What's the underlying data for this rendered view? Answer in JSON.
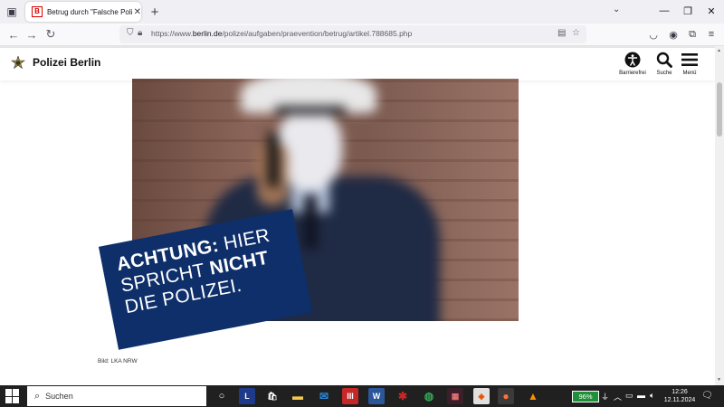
{
  "browser": {
    "tab_title": "Betrug durch \"Falsche Polizisten\"",
    "tab_favicon": "B",
    "url_prefix": "https://www.",
    "url_host": "berlin.de",
    "url_path": "/polizei/aufgaben/praevention/betrug/artikel.788685.php"
  },
  "site": {
    "title": "Polizei Berlin",
    "tools": [
      {
        "label": "Barrierefrei",
        "icon": "accessibility-icon"
      },
      {
        "label": "Suche",
        "icon": "search-icon"
      },
      {
        "label": "Menü",
        "icon": "hamburger-menu-icon"
      }
    ]
  },
  "hero": {
    "warning_line1_bold": "ACHTUNG:",
    "warning_line1_rest": " HIER",
    "warning_line2_rest": "SPRICHT ",
    "warning_line2_bold": "NICHT",
    "warning_line3": "DIE POLIZEI.",
    "warning_color": "#0e2f6a",
    "caption": "Bild: LKA NRW"
  },
  "taskbar": {
    "search_placeholder": "Suchen",
    "battery": "96%",
    "time": "12:26",
    "date": "12.11.2024",
    "apps": [
      "task-view",
      "launcher-l",
      "store",
      "file-explorer",
      "mail",
      "app-red",
      "word",
      "app-bug",
      "chrome",
      "app-dark",
      "app-orange",
      "firefox",
      "vlc"
    ]
  },
  "colors": {
    "accent_navy": "#0e2f6a",
    "favicon_red": "#dd0000",
    "battery_green": "#1f8f3a"
  }
}
